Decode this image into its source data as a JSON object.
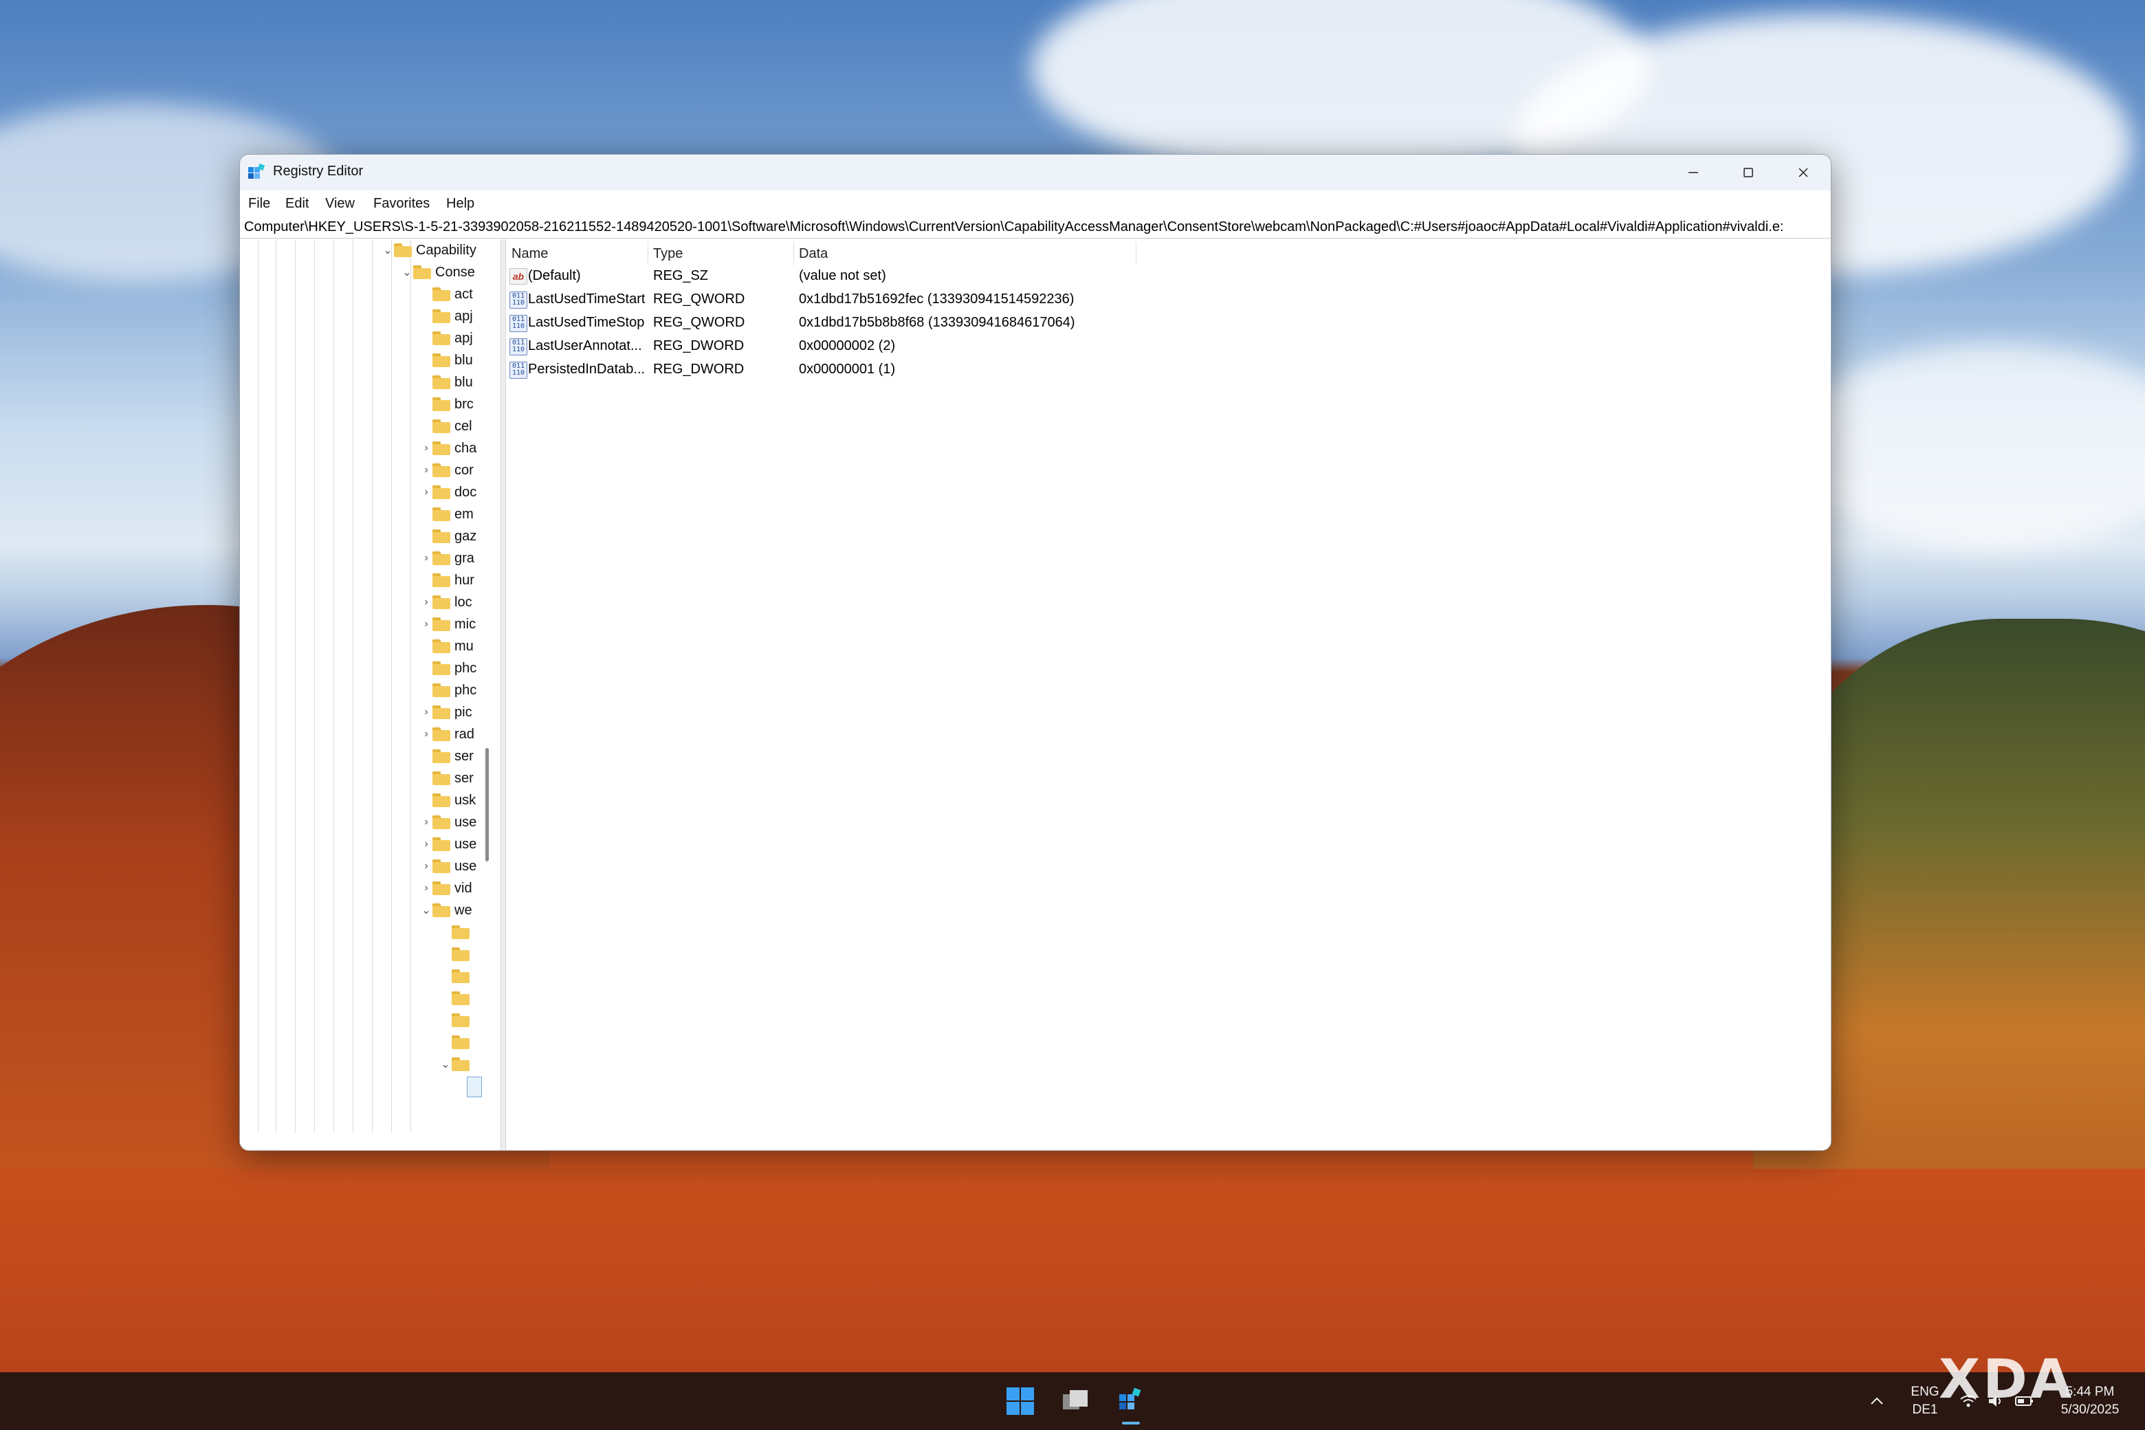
{
  "window": {
    "title": "Registry Editor",
    "address_path": "Computer\\HKEY_USERS\\S-1-5-21-3393902058-216211552-1489420520-1001\\Software\\Microsoft\\Windows\\CurrentVersion\\CapabilityAccessManager\\ConsentStore\\webcam\\NonPackaged\\C:#Users#joaoc#AppData#Local#Vivaldi#Application#vivaldi.e:"
  },
  "menu": [
    "File",
    "Edit",
    "View",
    "Favorites",
    "Help"
  ],
  "tree": {
    "capability": "Capability",
    "consent": "Conse",
    "items": [
      "act",
      "apj",
      "apj",
      "blu",
      "blu",
      "brc",
      "cel",
      "cha",
      "cor",
      "doc",
      "em",
      "gaz",
      "gra",
      "hur",
      "loc",
      "mic",
      "mu",
      "phc",
      "phc",
      "pic",
      "rad",
      "ser",
      "ser",
      "usk",
      "use",
      "use",
      "use",
      "vid",
      "we"
    ],
    "expandable_items": [
      "cha",
      "cor",
      "doc",
      "gra",
      "loc",
      "mic",
      "pic",
      "rad",
      "use",
      "vid"
    ]
  },
  "columns": {
    "name": "Name",
    "type": "Type",
    "data": "Data"
  },
  "values": [
    {
      "icon": "string-value-icon",
      "name": "(Default)",
      "type": "REG_SZ",
      "data": "(value not set)"
    },
    {
      "icon": "binary-value-icon",
      "name": "LastUsedTimeStart",
      "type": "REG_QWORD",
      "data": "0x1dbd17b51692fec (133930941514592236)"
    },
    {
      "icon": "binary-value-icon",
      "name": "LastUsedTimeStop",
      "type": "REG_QWORD",
      "data": "0x1dbd17b5b8b8f68 (133930941684617064)"
    },
    {
      "icon": "binary-value-icon",
      "name": "LastUserAnnotat...",
      "type": "REG_DWORD",
      "data": "0x00000002 (2)"
    },
    {
      "icon": "binary-value-icon",
      "name": "PersistedInDatab...",
      "type": "REG_DWORD",
      "data": "0x00000001 (1)"
    }
  ],
  "tray": {
    "lang_top": "ENG",
    "lang_bottom": "DE1",
    "time": "5:44 PM",
    "date": "5/30/2025"
  },
  "watermark": "XDA",
  "colors": {
    "accent": "#0078d4",
    "folder": "#f4cb5a",
    "taskbar": "#2a1712"
  }
}
